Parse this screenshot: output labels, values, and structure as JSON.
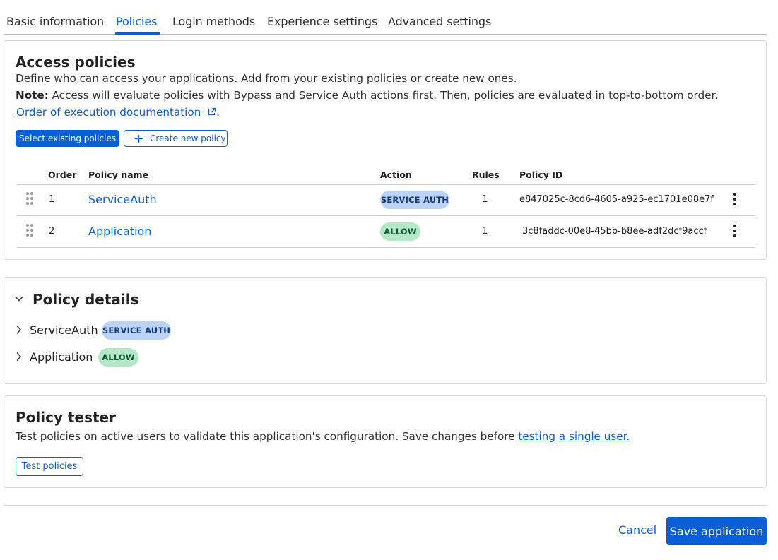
{
  "tabs": [
    {
      "label": "Basic information",
      "active": false
    },
    {
      "label": "Policies",
      "active": true
    },
    {
      "label": "Login methods",
      "active": false
    },
    {
      "label": "Experience settings",
      "active": false
    },
    {
      "label": "Advanced settings",
      "active": false
    }
  ],
  "access_policies": {
    "title": "Access policies",
    "description": "Define who can access your applications. Add from your existing policies or create new ones.",
    "note_label": "Note:",
    "note_text": "Access will evaluate policies with Bypass and Service Auth actions first. Then, policies are evaluated in top-to-bottom order.",
    "doc_link": "Order of execution documentation",
    "doc_suffix": ".",
    "select_button": "Select existing policies",
    "create_button": "Create new policy",
    "columns": {
      "order": "Order",
      "name": "Policy name",
      "action": "Action",
      "rules": "Rules",
      "id": "Policy ID"
    },
    "rows": [
      {
        "order": "1",
        "name": "ServiceAuth",
        "action": "SERVICE AUTH",
        "rules": "1",
        "id": "e847025c-8cd6-4605-a925-ec1701e08e7f"
      },
      {
        "order": "2",
        "name": "Application",
        "action": "ALLOW",
        "rules": "1",
        "id": "3c8faddc-00e8-45bb-b8ee-adf2dcf9accf"
      }
    ]
  },
  "policy_details": {
    "title": "Policy details",
    "items": [
      {
        "name": "ServiceAuth",
        "action": "SERVICE AUTH"
      },
      {
        "name": "Application",
        "action": "ALLOW"
      }
    ]
  },
  "policy_tester": {
    "title": "Policy tester",
    "text": "Test policies on active users to validate this application's configuration. Save changes before",
    "link": "testing a single user.",
    "button": "Test policies"
  },
  "footer": {
    "cancel": "Cancel",
    "save": "Save application"
  },
  "colors": {
    "accent": "#0a5fd6",
    "service_auth_badge": "#bcd2f7",
    "allow_badge": "#b3e7c6"
  }
}
